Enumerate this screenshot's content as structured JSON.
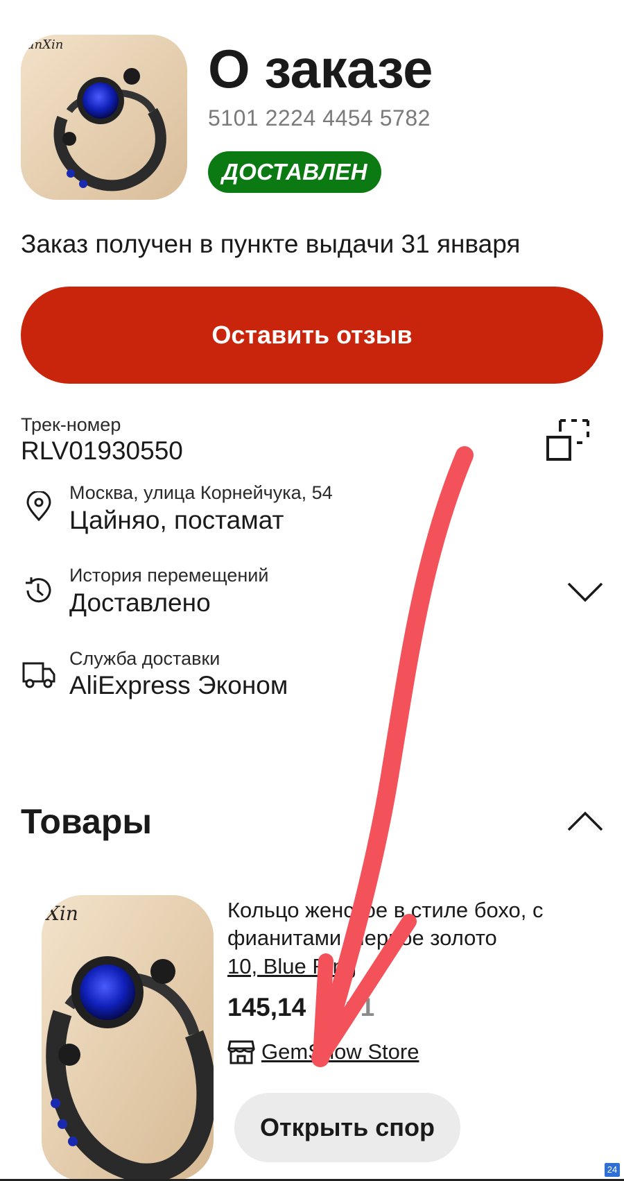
{
  "header": {
    "title": "О заказе",
    "order_number": "5101 2224 4454 5782",
    "status_badge": "ДОСТАВЛЕН",
    "thumb_logo": "unXin"
  },
  "received_text": "Заказ получен в пункте выдачи 31 января",
  "review_button": "Оставить отзыв",
  "tracking": {
    "label": "Трек-номер",
    "value": "RLV01930550",
    "copy_icon": "copy-icon"
  },
  "pickup": {
    "icon": "location-pin-icon",
    "label": "Москва, улица Корнейчука, 54",
    "value": "Цайняо, постамат"
  },
  "history": {
    "icon": "history-icon",
    "label": "История перемещений",
    "value": "Доставлено",
    "expand_icon": "chevron-down-icon"
  },
  "delivery": {
    "icon": "truck-icon",
    "label": "Служба доставки",
    "value": "AliExpress Эконом"
  },
  "products_section": {
    "title": "Товары",
    "collapse_icon": "chevron-up-icon"
  },
  "product": {
    "image_logo": "Xin",
    "title": "Кольцо женское в стиле бохо, с фианитами, черное золото",
    "variant": "10, Blue Ring",
    "price": "145,14",
    "quantity": "×1",
    "store_icon": "store-icon",
    "store": "GemShow Store",
    "dispute_button": "Открыть спор"
  },
  "corner_badge": "24",
  "colors": {
    "accent_red": "#c9250c",
    "status_green": "#0b7a12",
    "annotation_arrow": "#f4525a"
  }
}
